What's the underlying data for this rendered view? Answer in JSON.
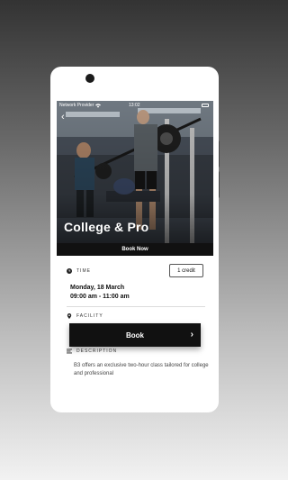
{
  "status_bar": {
    "carrier": "Network Provider",
    "time": "13:02"
  },
  "hero": {
    "title": "College & Pro",
    "book_bar_label": "Book Now"
  },
  "time_section": {
    "label": "TIME",
    "credit": "1 credit",
    "date": "Monday, 18 March",
    "hours": "09:00 am - 11:00 am"
  },
  "facility_section": {
    "label": "FACILITY"
  },
  "book_button": {
    "label": "Book"
  },
  "description_section": {
    "label": "DESCRIPTION",
    "text": "B3 offers an exclusive two-hour class tailored for college and professional"
  },
  "icons": [
    "back-arrow-icon",
    "wifi-icon",
    "battery-icon",
    "clock-icon",
    "location-pin-icon",
    "description-icon",
    "chevron-right-icon"
  ],
  "colors": {
    "primary_button": "#111111",
    "text": "#111111"
  }
}
